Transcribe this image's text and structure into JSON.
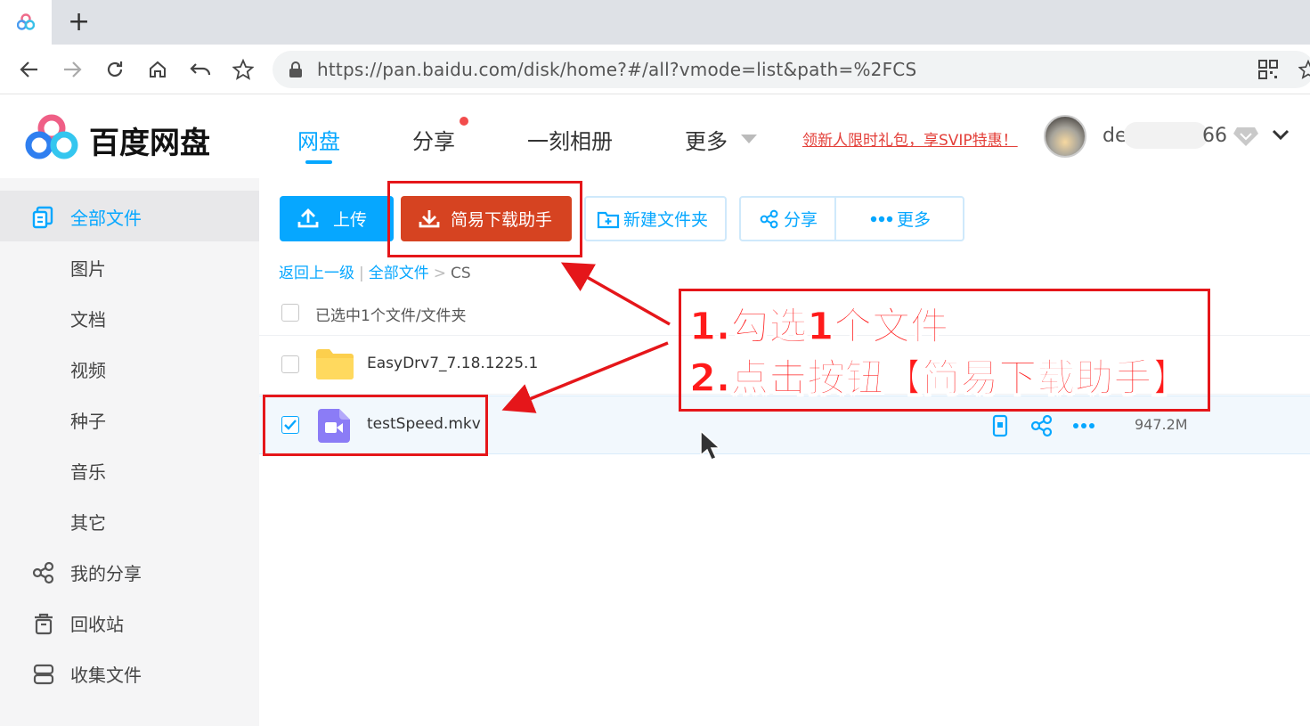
{
  "browser": {
    "url": "https://pan.baidu.com/disk/home?#/all?vmode=list&path=%2FCS",
    "new_tab_glyph": "+"
  },
  "header": {
    "brand": "百度网盘",
    "nav": [
      {
        "label": "网盘",
        "active": true
      },
      {
        "label": "分享",
        "badge": true
      },
      {
        "label": "一刻相册"
      },
      {
        "label": "更多"
      }
    ],
    "promo": "领新人限时礼包，享SVIP特惠！",
    "username_start": "de",
    "username_end": "66"
  },
  "sidebar": {
    "items": [
      {
        "label": "全部文件",
        "icon": "all-files-icon",
        "active": true
      },
      {
        "label": "图片"
      },
      {
        "label": "文档"
      },
      {
        "label": "视频"
      },
      {
        "label": "种子"
      },
      {
        "label": "音乐"
      },
      {
        "label": "其它"
      },
      {
        "label": "我的分享",
        "icon": "share-icon"
      },
      {
        "label": "回收站",
        "icon": "trash-icon"
      },
      {
        "label": "收集文件",
        "icon": "collect-icon"
      }
    ]
  },
  "toolbar": {
    "upload_label": "上传",
    "download_helper_label": "简易下载助手",
    "new_folder_label": "新建文件夹",
    "share_label": "分享",
    "more_label": "更多"
  },
  "breadcrumb": {
    "back": "返回上一级",
    "root": "全部文件",
    "separator": ">",
    "current": "CS"
  },
  "selection_label": "已选中1个文件/文件夹",
  "files": [
    {
      "name": "EasyDrv7_7.18.1225.1",
      "type": "folder",
      "checked": false,
      "size": ""
    },
    {
      "name": "testSpeed.mkv",
      "type": "video",
      "checked": true,
      "size": "947.2M"
    }
  ],
  "annotation": {
    "line1": "1.勾选1个文件",
    "line2": "2.点击按钮【简易下载助手】",
    "color": "#e5161a"
  },
  "colors": {
    "accent": "#06a7ff",
    "download_button": "#d64321",
    "annotation_red": "#e5161a"
  }
}
